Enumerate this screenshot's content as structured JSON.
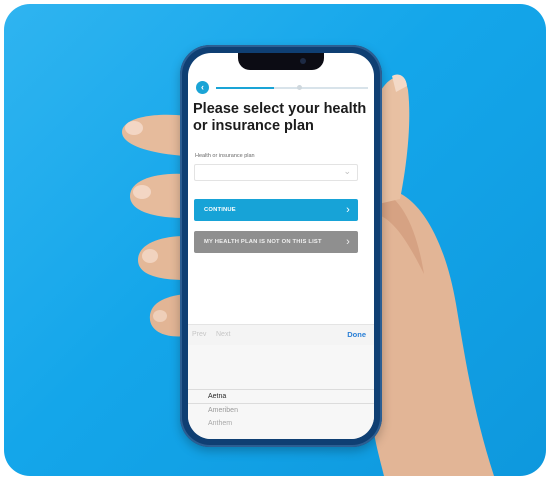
{
  "screen": {
    "title": "Please select your health or insurance plan",
    "field_label": "Health or insurance plan",
    "select_value": "",
    "progress_fraction": 0.38
  },
  "buttons": {
    "continue": "CONTINUE",
    "not_listed": "MY HEALTH PLAN IS NOT ON THIS LIST"
  },
  "keyboard_toolbar": {
    "prev": "Prev",
    "next": "Next",
    "done": "Done"
  },
  "picker": {
    "options": [
      "Aetna",
      "Ameriben",
      "Anthem"
    ]
  },
  "icons": {
    "back": "back-arrow-icon",
    "chevron": "chevron-right-icon",
    "dropdown": "chevron-down-icon"
  },
  "colors": {
    "background": "#14a6ea",
    "accent": "#17a3d7",
    "secondary_button": "#8f8f8f",
    "done_link": "#2a7fd6"
  }
}
